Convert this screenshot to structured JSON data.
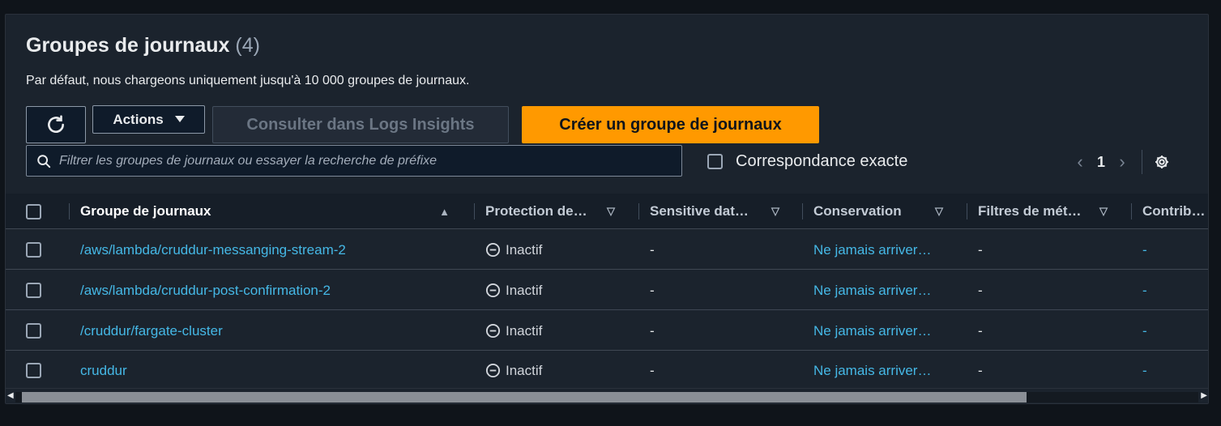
{
  "header": {
    "title": "Groupes de journaux",
    "count": "(4)",
    "description": "Par défaut, nous chargeons uniquement jusqu'à 10 000 groupes de journaux."
  },
  "toolbar": {
    "refresh_icon": "refresh-icon",
    "actions_label": "Actions",
    "insights_label": "Consulter dans Logs Insights",
    "create_label": "Créer un groupe de journaux"
  },
  "filter": {
    "placeholder": "Filtrer les groupes de journaux ou essayer la recherche de préfixe",
    "exact_match_label": "Correspondance exacte"
  },
  "pagination": {
    "current_page": "1"
  },
  "table": {
    "columns": [
      "Groupe de journaux",
      "Protection de…",
      "Sensitive dat…",
      "Conservation",
      "Filtres de mét…",
      "Contributo"
    ],
    "rows": [
      {
        "name": "/aws/lambda/cruddur-messanging-stream-2",
        "protection": "Inactif",
        "sensitive": "-",
        "retention": "Ne jamais arriver…",
        "filters": "-",
        "contributor": "-"
      },
      {
        "name": "/aws/lambda/cruddur-post-confirmation-2",
        "protection": "Inactif",
        "sensitive": "-",
        "retention": "Ne jamais arriver…",
        "filters": "-",
        "contributor": "-"
      },
      {
        "name": "/cruddur/fargate-cluster",
        "protection": "Inactif",
        "sensitive": "-",
        "retention": "Ne jamais arriver…",
        "filters": "-",
        "contributor": "-"
      },
      {
        "name": "cruddur",
        "protection": "Inactif",
        "sensitive": "-",
        "retention": "Ne jamais arriver…",
        "filters": "-",
        "contributor": "-"
      }
    ]
  },
  "colors": {
    "background": "#0f141a",
    "panel": "#1b232d",
    "primary_button": "#ff9900",
    "link": "#45b8e6"
  }
}
